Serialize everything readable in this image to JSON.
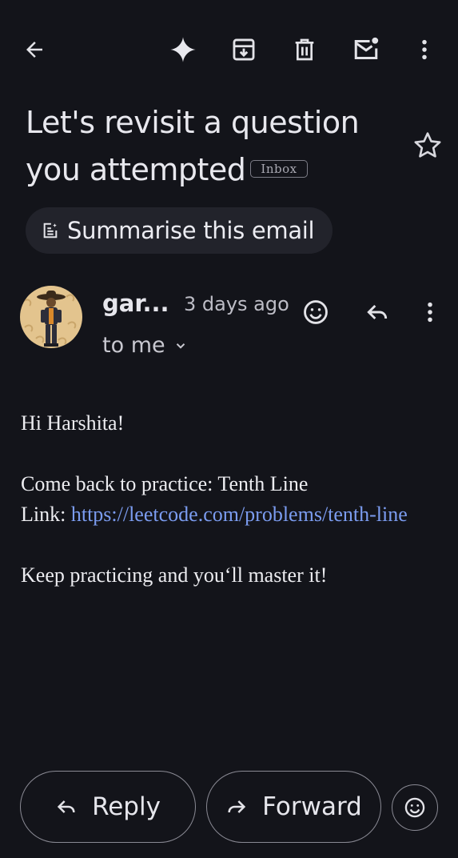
{
  "toolbar": {
    "icons": [
      "back-arrow-icon",
      "gemini-sparkle-icon",
      "archive-icon",
      "delete-icon",
      "mark-unread-icon",
      "more-vert-icon"
    ]
  },
  "email": {
    "subject": "Let's revisit a question you attempted",
    "label_chip": "Inbox",
    "summarise_label": "Summarise this email",
    "sender": "gar...",
    "time": "3 days ago",
    "recipient": "to me",
    "body": {
      "greeting": "Hi Harshita!",
      "line1": "Come back to practice: Tenth Line",
      "link_prefix": "Link: ",
      "link_text": "https://leetcode.com/problems/tenth-line",
      "closing": "Keep practicing and you‘ll master it!"
    }
  },
  "actions": {
    "reply_label": "Reply",
    "forward_label": "Forward"
  },
  "colors": {
    "background": "#13141a",
    "chip_bg": "#22232b",
    "link": "#7b9cf0",
    "text": "#e3e3e8"
  }
}
